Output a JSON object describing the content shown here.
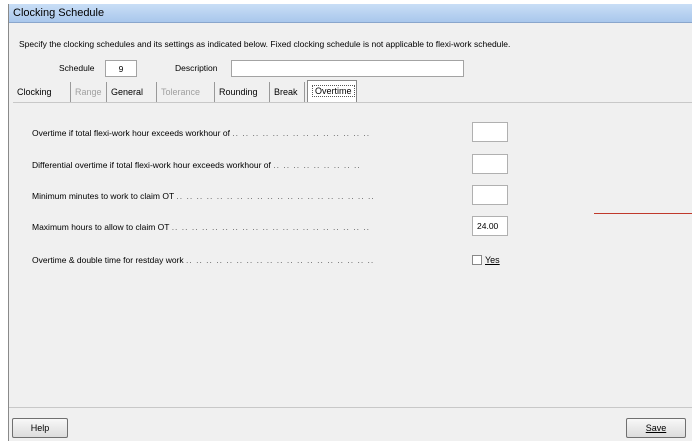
{
  "window": {
    "title": "Clocking Schedule"
  },
  "instructions": "Specify the clocking schedules and its settings as indicated below. Fixed clocking schedule is not applicable to flexi-work schedule.",
  "header": {
    "schedule_label": "Schedule",
    "schedule_value": "9",
    "description_label": "Description",
    "description_value": ""
  },
  "tabs": [
    {
      "label": "Clocking",
      "state": "normal"
    },
    {
      "label": "Range",
      "state": "disabled"
    },
    {
      "label": "General",
      "state": "normal"
    },
    {
      "label": "Tolerance",
      "state": "disabled"
    },
    {
      "label": "Rounding",
      "state": "normal"
    },
    {
      "label": "Break",
      "state": "normal"
    },
    {
      "label": "Overtime",
      "state": "active"
    }
  ],
  "overtime": {
    "rows": [
      {
        "label": "Overtime if total flexi-work hour exceeds workhour of",
        "dots": ".. .. .. .. .. .. .. .. .. .. .. .. .. ..",
        "value": ""
      },
      {
        "label": "Differential overtime if total flexi-work hour exceeds workhour of",
        "dots": ".. .. .. .. .. .. .. .. ..",
        "value": ""
      },
      {
        "label": "Minimum minutes to work to claim OT",
        "dots": ".. .. .. .. .. .. .. .. .. .. .. .. .. .. .. .. .. .. .. ..",
        "value": ""
      },
      {
        "label": "Maximum hours to allow to claim OT",
        "dots": ".. .. .. .. .. .. .. .. .. .. .. .. .. .. .. .. .. .. .. ..",
        "value": "24.00"
      }
    ],
    "restday_label": "Overtime & double time for restday work",
    "restday_dots": ".. .. .. .. .. .. .. .. .. .. .. .. .. .. .. .. .. .. ..",
    "restday_checkbox_label": "Yes"
  },
  "buttons": {
    "help": "Help",
    "save": "Save"
  },
  "colors": {
    "annotation_line": "#c0392b",
    "titlebar": "#b9d3f2"
  }
}
